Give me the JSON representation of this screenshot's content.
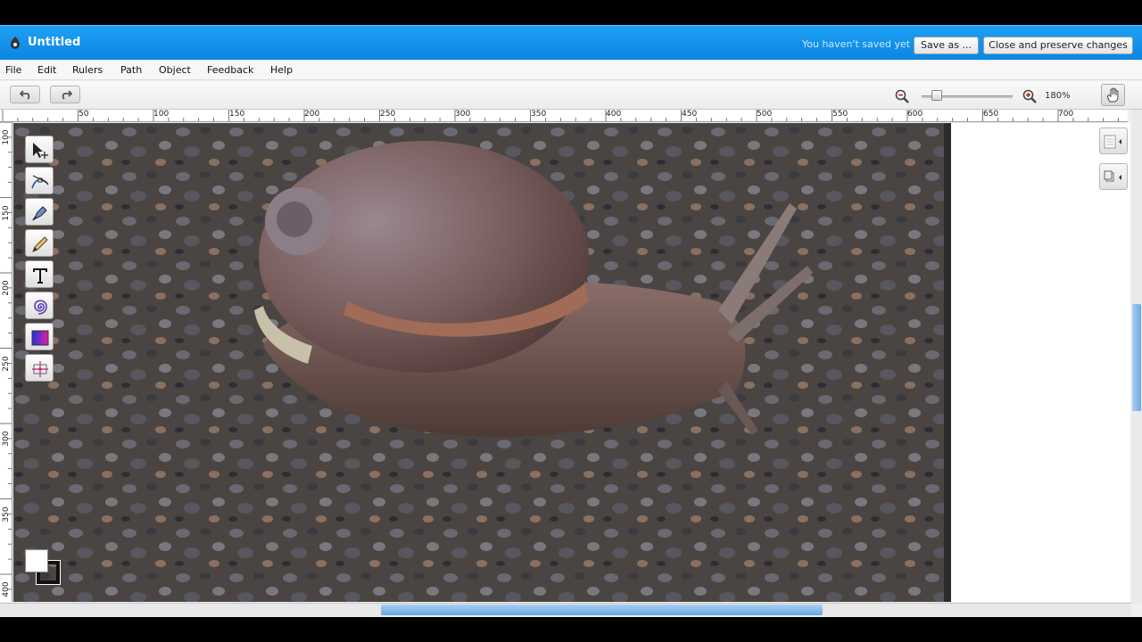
{
  "window": {
    "title": "Untitled",
    "save_status": "You haven't saved yet"
  },
  "buttons": {
    "save_as": "Save as ...",
    "close_preserve": "Close and preserve changes"
  },
  "menu": [
    "File",
    "Edit",
    "Rulers",
    "Path",
    "Object",
    "Feedback",
    "Help"
  ],
  "toolbar": {
    "zoom_level": "180%"
  },
  "ruler_h": [
    "50",
    "100",
    "150",
    "200",
    "250",
    "300",
    "350",
    "400",
    "450",
    "500",
    "550",
    "600",
    "650",
    "700"
  ],
  "ruler_v": [
    "100",
    "150",
    "200",
    "250",
    "300",
    "350",
    "400"
  ],
  "tools": [
    "select-tool-icon",
    "node-edit-tool-icon",
    "pen-tool-icon",
    "pencil-tool-icon",
    "text-tool-icon",
    "spiral-tool-icon",
    "gradient-tool-icon",
    "transform-tool-icon"
  ],
  "colors": {
    "title_bar": "#0a86e2",
    "canvas_background": "#2b2b2b"
  },
  "canvas": {
    "image_subject": "snail"
  }
}
